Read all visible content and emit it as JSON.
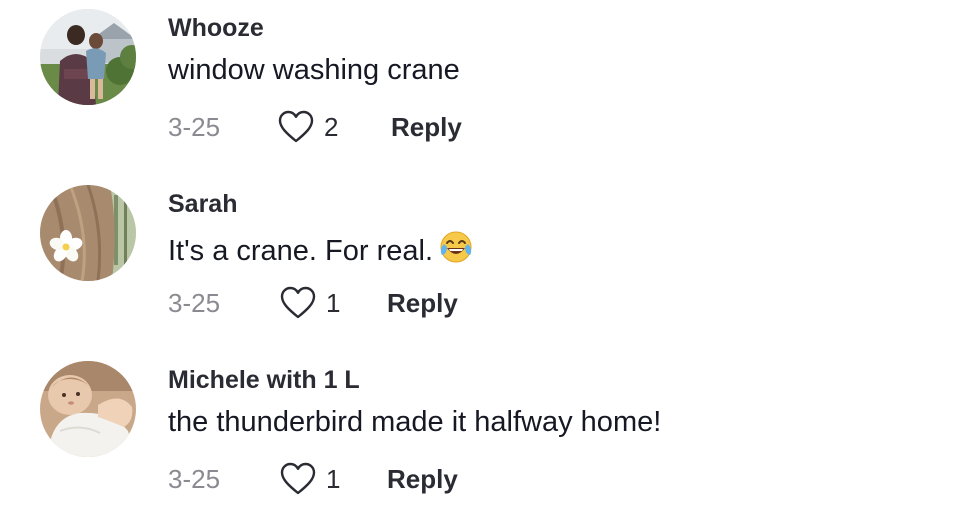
{
  "comments": [
    {
      "username": "Whooze",
      "text": "window washing crane",
      "date": "3-25",
      "likes": "2",
      "reply_label": "Reply",
      "avatar_icon": "man-holding-child-photo"
    },
    {
      "username": "Sarah",
      "text": "It's a crane. For real.",
      "emoji": "face-with-tears-of-joy",
      "date": "3-25",
      "likes": "1",
      "reply_label": "Reply",
      "avatar_icon": "hair-with-flower-clip-photo"
    },
    {
      "username": "Michele with 1 L",
      "text": "the thunderbird made it halfway home!",
      "date": "3-25",
      "likes": "1",
      "reply_label": "Reply",
      "avatar_icon": "baby-photo"
    }
  ],
  "colors": {
    "username": "#2a2b33",
    "text": "#161823",
    "date": "#8a8b91",
    "heart_outline": "#2a2b33"
  }
}
